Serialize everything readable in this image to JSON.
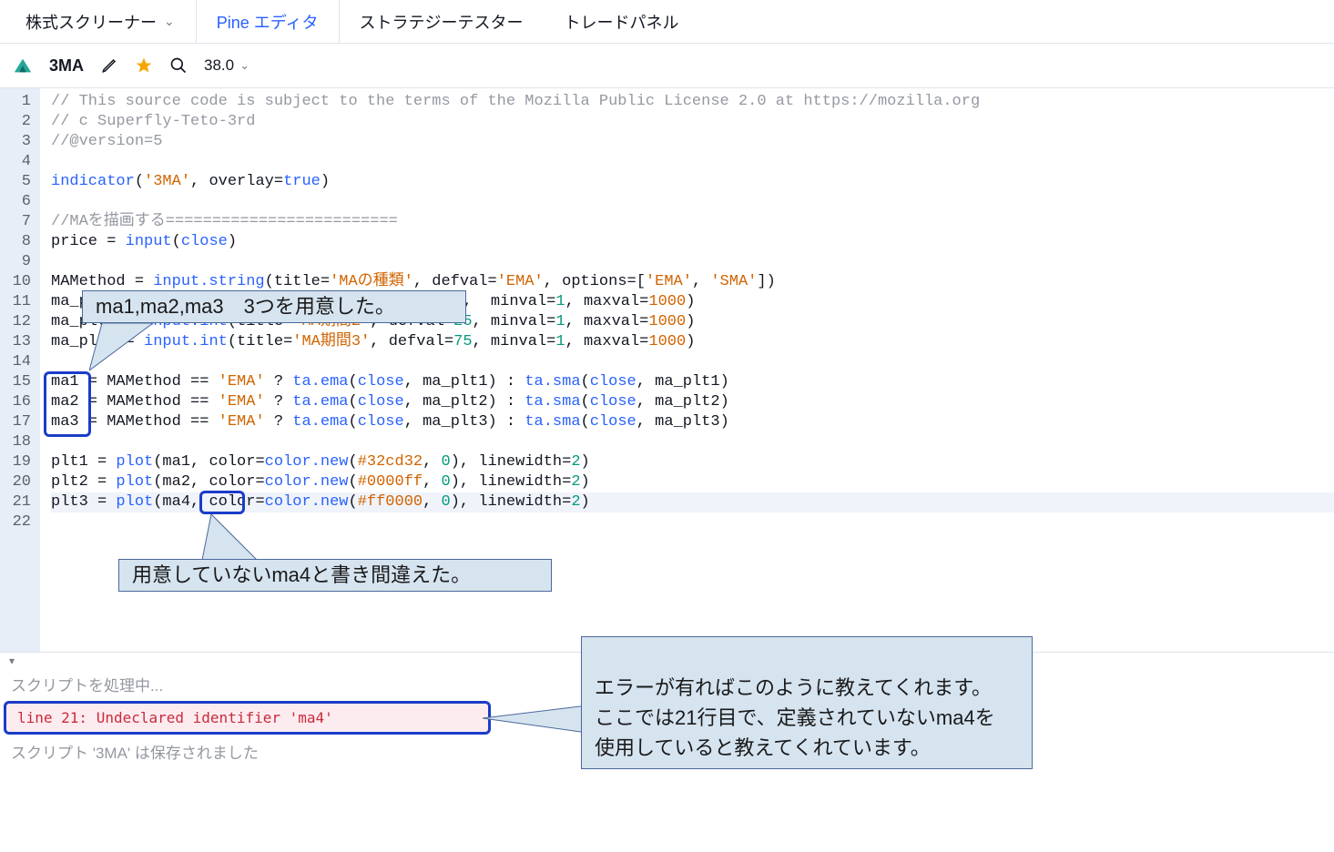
{
  "tabs": {
    "screener": "株式スクリーナー",
    "pine": "Pine エディタ",
    "strategy": "ストラテジーテスター",
    "trade": "トレードパネル"
  },
  "toolbar": {
    "script_name": "3MA",
    "version": "38.0"
  },
  "code_lines": [
    {
      "n": 1,
      "type": "cmt",
      "text": "// This source code is subject to the terms of the Mozilla Public License 2.0 at https://mozilla.org"
    },
    {
      "n": 2,
      "type": "cmt",
      "text": "// c Superfly-Teto-3rd"
    },
    {
      "n": 3,
      "type": "cmt",
      "text": "//@version=5"
    },
    {
      "n": 4,
      "type": "blank",
      "text": ""
    },
    {
      "n": 5,
      "type": "ind",
      "text": "indicator('3MA', overlay=true)"
    },
    {
      "n": 6,
      "type": "blank",
      "text": ""
    },
    {
      "n": 7,
      "type": "cmt",
      "text": "//MAを描画する========================="
    },
    {
      "n": 8,
      "type": "price",
      "text": "price = input(close)"
    },
    {
      "n": 9,
      "type": "blank",
      "text": ""
    },
    {
      "n": 10,
      "type": "mamethod",
      "text": "MAMethod = input.string(title='MAの種類', defval='EMA', options=['EMA', 'SMA'])"
    },
    {
      "n": 11,
      "type": "maplt",
      "text": "ma_plt1 = input.int(title='MA期間1', defval=5,  minval=1, maxval=1000)"
    },
    {
      "n": 12,
      "type": "maplt",
      "text": "ma_plt2 = input.int(title='MA期間2', defval=25, minval=1, maxval=1000)"
    },
    {
      "n": 13,
      "type": "maplt",
      "text": "ma_plt3 = input.int(title='MA期間3', defval=75, minval=1, maxval=1000)"
    },
    {
      "n": 14,
      "type": "blank",
      "text": ""
    },
    {
      "n": 15,
      "type": "madef",
      "text": "ma1 = MAMethod == 'EMA' ? ta.ema(close, ma_plt1) : ta.sma(close, ma_plt1)"
    },
    {
      "n": 16,
      "type": "madef",
      "text": "ma2 = MAMethod == 'EMA' ? ta.ema(close, ma_plt2) : ta.sma(close, ma_plt2)"
    },
    {
      "n": 17,
      "type": "madef",
      "text": "ma3 = MAMethod == 'EMA' ? ta.ema(close, ma_plt3) : ta.sma(close, ma_plt3)"
    },
    {
      "n": 18,
      "type": "blank",
      "text": ""
    },
    {
      "n": 19,
      "type": "plot",
      "text": "plt1 = plot(ma1, color=color.new(#32cd32, 0), linewidth=2)"
    },
    {
      "n": 20,
      "type": "plot",
      "text": "plt2 = plot(ma2, color=color.new(#0000ff, 0), linewidth=2)"
    },
    {
      "n": 21,
      "type": "plot",
      "text": "plt3 = plot(ma4, color=color.new(#ff0000, 0), linewidth=2)"
    },
    {
      "n": 22,
      "type": "blank",
      "text": ""
    }
  ],
  "callouts": {
    "c1": "ma1,ma2,ma3　3つを用意した。",
    "c2": "用意していないma4と書き間違えた。",
    "c3": "エラーが有ればこのように教えてくれます。\nここでは21行目で、定義されていないma4を\n使用していると教えてくれています。"
  },
  "status": {
    "processing": "スクリプトを処理中...",
    "error": "line 21: Undeclared identifier 'ma4'",
    "saved": "スクリプト '3MA' は保存されました"
  }
}
